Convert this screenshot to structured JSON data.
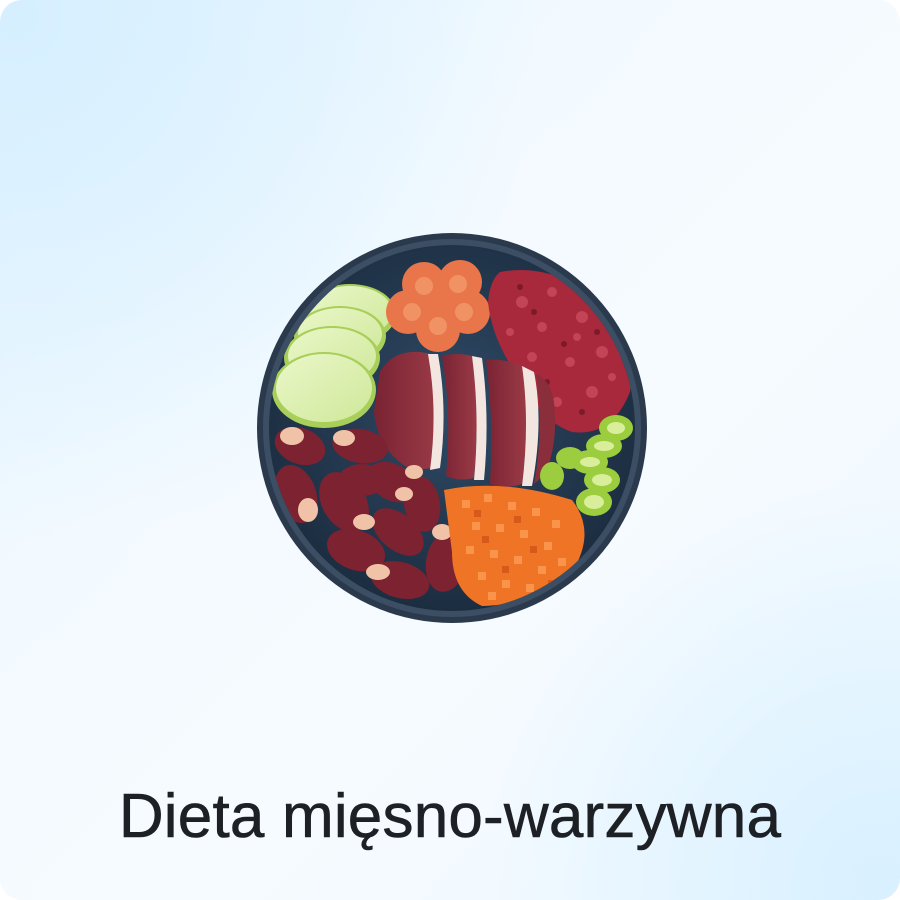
{
  "card": {
    "title": "Dieta mięsno-warzywna",
    "image": {
      "icon": "food-bowl-icon",
      "contents": [
        "cucumber-slices",
        "vegetable-patty",
        "minced-meat",
        "duck-breast-slices",
        "chicken-hearts",
        "diced-carrot",
        "celery-slices"
      ]
    }
  },
  "colors": {
    "title_text": "#1d2125",
    "background_tint": "#e4f4ff",
    "bowl": "#22344a"
  }
}
